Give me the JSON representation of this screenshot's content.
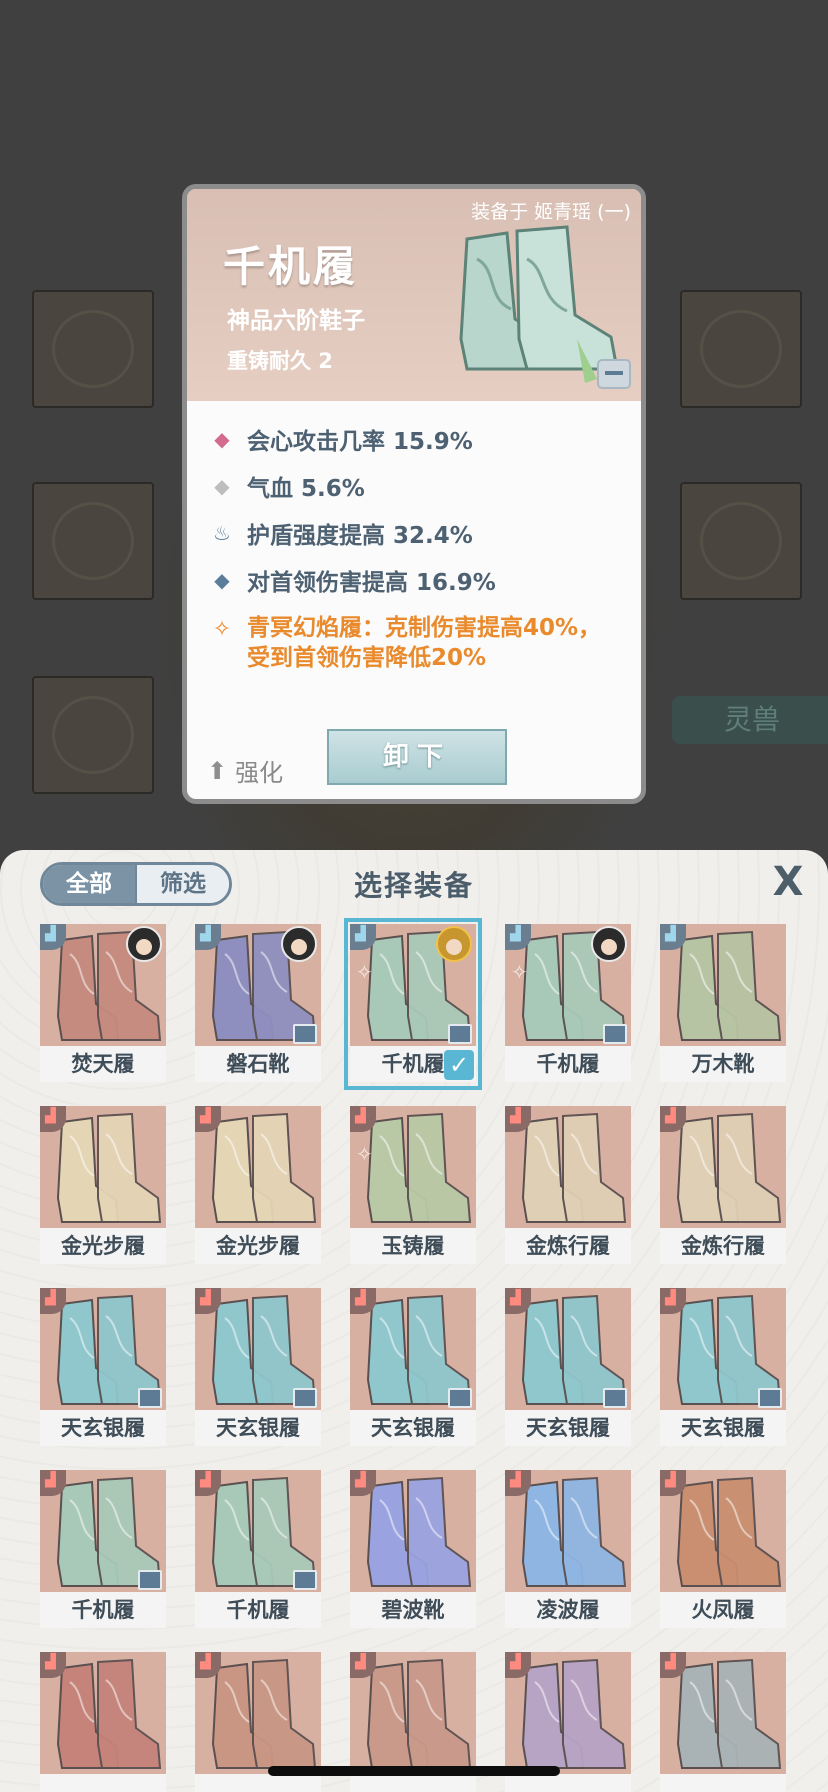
{
  "background": {
    "beast_label": "灵兽"
  },
  "detail_card": {
    "equipped_tag": "装备于 姬青瑶 (一)",
    "item_name": "千机履",
    "grade": "神品六阶鞋子",
    "durability": "重铸耐久 2",
    "stats": [
      {
        "icon": "pink-diamond-icon",
        "color": "#d36b8c",
        "text": "会心攻击几率 15.9%"
      },
      {
        "icon": "gray-diamond-icon",
        "color": "#bdbdbd",
        "text": "气血 5.6%"
      },
      {
        "icon": "shield-flame-icon",
        "color": "#5b7d99",
        "text": "护盾强度提高 32.4%"
      },
      {
        "icon": "blue-diamond-icon",
        "color": "#5b7d99",
        "text": "对首领伤害提高 16.9%"
      }
    ],
    "special_effect_line1": "青冥幻焰履：克制伤害提高40%，",
    "special_effect_line2": "受到首领伤害降低20%",
    "strengthen_label": "强化",
    "unequip_label": "卸下"
  },
  "panel": {
    "tab_all": "全部",
    "tab_filter": "筛选",
    "title": "选择装备",
    "close_label": "X",
    "items": [
      {
        "name": "焚天履",
        "color": "#c58b7e",
        "corner": "blue",
        "avatar": true
      },
      {
        "name": "磐石靴",
        "color": "#8f8fbf",
        "corner": "blue",
        "avatar": true,
        "chest": true
      },
      {
        "name": "千机履",
        "color": "#a9c9b8",
        "corner": "blue",
        "avatar": true,
        "gold": true,
        "chest": true,
        "rune": true,
        "selected": true
      },
      {
        "name": "千机履",
        "color": "#a9c9b8",
        "corner": "blue",
        "avatar": true,
        "chest": true,
        "rune": true
      },
      {
        "name": "万木靴",
        "color": "#b7c4a4",
        "corner": "blue"
      },
      {
        "name": "金光步履",
        "color": "#e4d5b5",
        "corner": "red"
      },
      {
        "name": "金光步履",
        "color": "#e4d5b5",
        "corner": "red"
      },
      {
        "name": "玉铸履",
        "color": "#b9c9a6",
        "corner": "red",
        "rune": true
      },
      {
        "name": "金炼行履",
        "color": "#dfcfb4",
        "corner": "red"
      },
      {
        "name": "金炼行履",
        "color": "#dfcfb4",
        "corner": "red"
      },
      {
        "name": "天玄银履",
        "color": "#8fc7cd",
        "corner": "red",
        "chest": true
      },
      {
        "name": "天玄银履",
        "color": "#8fc7cd",
        "corner": "red",
        "chest": true
      },
      {
        "name": "天玄银履",
        "color": "#8fc7cd",
        "corner": "red",
        "chest": true
      },
      {
        "name": "天玄银履",
        "color": "#8fc7cd",
        "corner": "red",
        "chest": true
      },
      {
        "name": "天玄银履",
        "color": "#8fc7cd",
        "corner": "red",
        "chest": true
      },
      {
        "name": "千机履",
        "color": "#a9c9b8",
        "corner": "red",
        "chest": true
      },
      {
        "name": "千机履",
        "color": "#a9c9b8",
        "corner": "red",
        "chest": true
      },
      {
        "name": "碧波靴",
        "color": "#9aa3e0",
        "corner": "red"
      },
      {
        "name": "凌波履",
        "color": "#8fb6e3",
        "corner": "red"
      },
      {
        "name": "火凤履",
        "color": "#c98f70",
        "corner": "red"
      },
      {
        "name": "",
        "color": "#c6837a",
        "corner": "red"
      },
      {
        "name": "",
        "color": "#c99684",
        "corner": "red"
      },
      {
        "name": "",
        "color": "#c9998a",
        "corner": "red"
      },
      {
        "name": "",
        "color": "#b7a3c4",
        "corner": "red"
      },
      {
        "name": "",
        "color": "#a9b3b6",
        "corner": "red"
      }
    ]
  }
}
